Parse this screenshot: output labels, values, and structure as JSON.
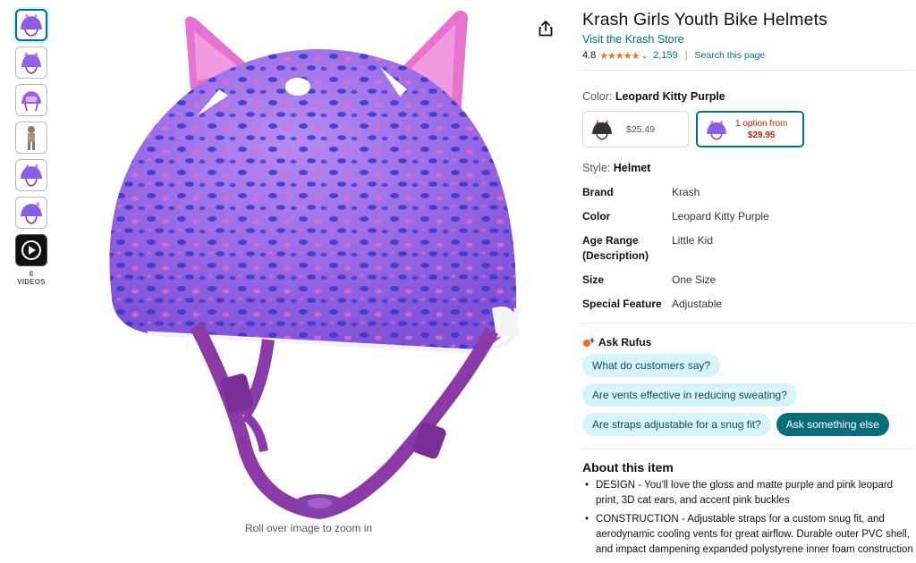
{
  "product": {
    "title": "Krash Girls Youth Bike Helmets",
    "store_link": "Visit the Krash Store",
    "rating": "4.8",
    "stars": "★★★★★",
    "review_count": "2,159",
    "search_page": "Search this page"
  },
  "gallery": {
    "videos_label": "6 VIDEOS",
    "zoom_hint": "Roll over image to zoom in"
  },
  "color": {
    "label": "Color:",
    "value": "Leopard Kitty Purple",
    "options": [
      {
        "price": "$25.49"
      },
      {
        "option_text": "1 option from",
        "price": "$29.95"
      }
    ]
  },
  "style": {
    "label": "Style:",
    "value": "Helmet"
  },
  "specs": [
    {
      "key": "Brand",
      "value": "Krash"
    },
    {
      "key": "Color",
      "value": "Leopard Kitty Purple"
    },
    {
      "key": "Age Range (Description)",
      "value": "Little Kid"
    },
    {
      "key": "Size",
      "value": "One Size"
    },
    {
      "key": "Special Feature",
      "value": "Adjustable"
    }
  ],
  "rufus": {
    "title": "Ask Rufus",
    "questions": [
      "What do customers say?",
      "Are vents effective in reducing sweating?",
      "Are straps adjustable for a snug fit?",
      "Ask something else"
    ]
  },
  "about": {
    "title": "About this item",
    "bullets": [
      "DESIGN - You'll love the gloss and matte purple and pink leopard print, 3D cat ears, and accent pink buckles",
      "CONSTRUCTION - Adjustable straps for a custom snug fit, and aerodynamic cooling vents for great airflow. Durable outer PVC shell, and impact dampening expanded polystyrene inner foam construction"
    ]
  },
  "colors": {
    "link": "#007185",
    "star": "#de7921",
    "price_red": "#b12704",
    "chip_bg": "#d6f4f9",
    "chip_dark": "#0a6d7a",
    "helmet_purple": "#9a6ae8",
    "ear_pink": "#e56fc8"
  }
}
